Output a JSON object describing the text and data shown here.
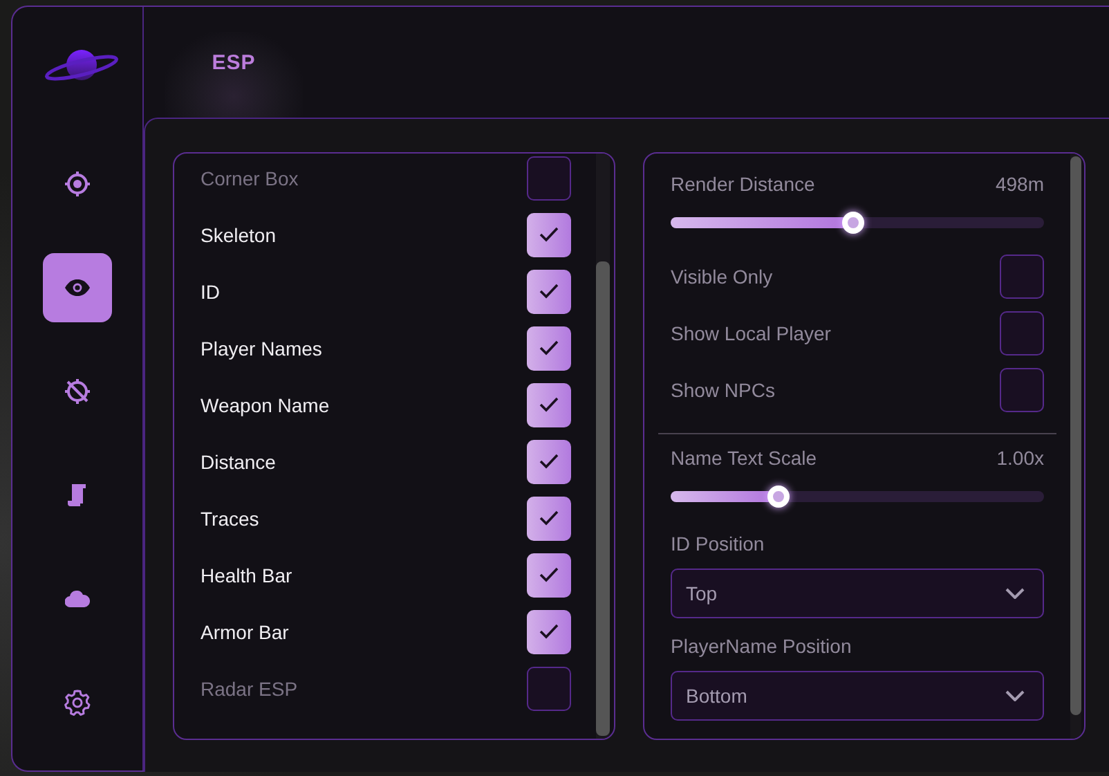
{
  "sidebar": {
    "items": [
      {
        "selected": false
      },
      {
        "selected": true
      },
      {
        "selected": false
      },
      {
        "selected": false
      },
      {
        "selected": false
      },
      {
        "selected": false
      }
    ]
  },
  "header": {
    "tabs": [
      {
        "label": "ESP",
        "selected": true
      }
    ]
  },
  "left_panel": {
    "items": [
      {
        "label": "Corner Box",
        "checked": false
      },
      {
        "label": "Skeleton",
        "checked": true
      },
      {
        "label": "ID",
        "checked": true
      },
      {
        "label": "Player Names",
        "checked": true
      },
      {
        "label": "Weapon Name",
        "checked": true
      },
      {
        "label": "Distance",
        "checked": true
      },
      {
        "label": "Traces",
        "checked": true
      },
      {
        "label": "Health Bar",
        "checked": true
      },
      {
        "label": "Armor Bar",
        "checked": true
      },
      {
        "label": "Radar ESP",
        "checked": false
      }
    ]
  },
  "right_panel": {
    "items": [
      {
        "kind": "slider",
        "label": "Render Distance",
        "reading": "498m",
        "level": 0.49
      },
      {
        "kind": "checkbox",
        "label": "Visible Only",
        "checked": false
      },
      {
        "kind": "checkbox",
        "label": "Show Local Player",
        "checked": false
      },
      {
        "kind": "checkbox",
        "label": "Show NPCs",
        "checked": false
      },
      {
        "kind": "divider"
      },
      {
        "kind": "slider",
        "label": "Name Text Scale",
        "reading": "1.00x",
        "level": 0.29
      },
      {
        "kind": "dropdown",
        "label": "ID Position",
        "value": "Top"
      },
      {
        "kind": "dropdown",
        "label": "PlayerName Position",
        "value": "Bottom"
      }
    ]
  }
}
